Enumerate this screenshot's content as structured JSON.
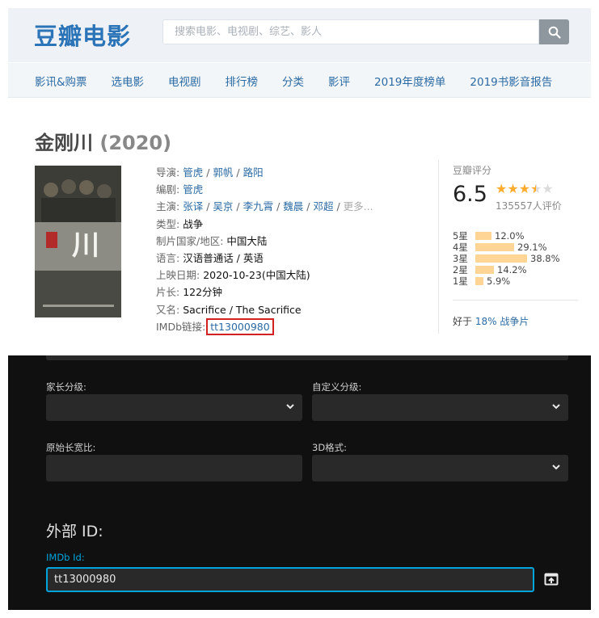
{
  "douban": {
    "logo": "豆瓣电影",
    "search": {
      "placeholder": "搜索电影、电视剧、综艺、影人"
    },
    "nav": [
      "影讯&购票",
      "选电影",
      "电视剧",
      "排行榜",
      "分类",
      "影评",
      "2019年度榜单",
      "2019书影音报告"
    ],
    "movie": {
      "title": "金刚川",
      "year": "(2020)",
      "directors_label": "导演:",
      "directors": [
        "管虎",
        "郭帆",
        "路阳"
      ],
      "writer_label": "编剧:",
      "writer": "管虎",
      "cast_label": "主演:",
      "cast": [
        "张译",
        "吴京",
        "李九霄",
        "魏晨",
        "邓超"
      ],
      "cast_more": "更多...",
      "genre_label": "类型:",
      "genre": "战争",
      "country_label": "制片国家/地区:",
      "country": "中国大陆",
      "language_label": "语言:",
      "language": "汉语普通话 / 英语",
      "release_label": "上映日期:",
      "release": "2020-10-23(中国大陆)",
      "runtime_label": "片长:",
      "runtime": "122分钟",
      "aka_label": "又名:",
      "aka": "Sacrifice / The Sacrifice",
      "imdb_label": "IMDb链接:",
      "imdb": "tt13000980"
    },
    "rating": {
      "label": "豆瓣评分",
      "score": "6.5",
      "stars_value": 3.5,
      "count": "135557人评价",
      "bars": [
        {
          "label": "5星",
          "pct": "12.0%",
          "value": 12.0
        },
        {
          "label": "4星",
          "pct": "29.1%",
          "value": 29.1
        },
        {
          "label": "3星",
          "pct": "38.8%",
          "value": 38.8
        },
        {
          "label": "2星",
          "pct": "14.2%",
          "value": 14.2
        },
        {
          "label": "1星",
          "pct": "5.9%",
          "value": 5.9
        }
      ],
      "better_prefix": "好于",
      "better_link": "18% 战争片"
    }
  },
  "editor": {
    "parental_label": "家长分级:",
    "custom_label": "自定义分级:",
    "aspect_label": "原始长宽比:",
    "format3d_label": "3D格式:",
    "external_ids_heading": "外部 ID:",
    "imdb_id_label": "IMDb Id:",
    "imdb_id_value": "tt13000980"
  },
  "colors": {
    "douban_blue": "#2b74b7",
    "star": "#ffac2d",
    "bar": "#ffd595",
    "jellyfin_accent": "#00a4dc",
    "highlight_box": "#d32020"
  }
}
